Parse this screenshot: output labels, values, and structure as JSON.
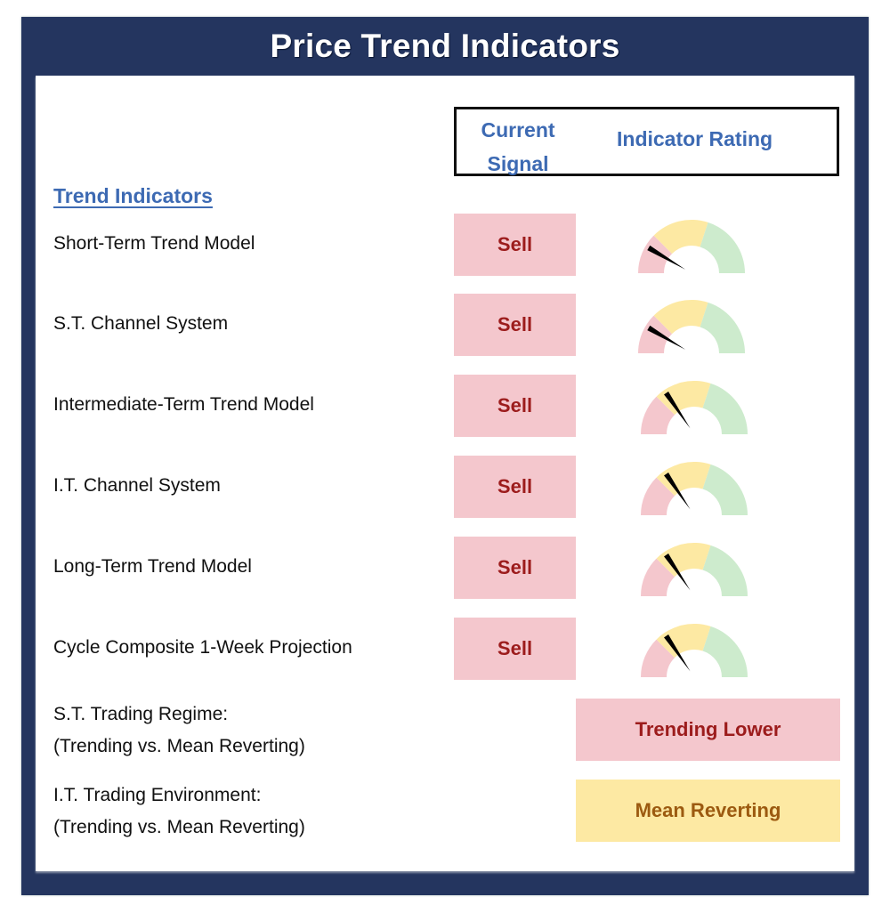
{
  "title": "Price Trend Indicators",
  "header": {
    "signal_line1": "Current",
    "signal_line2": "Signal",
    "rating": "Indicator Rating"
  },
  "section_heading": "Trend Indicators",
  "gauge_zones": {
    "red": {
      "from": 0.0,
      "to": 0.25,
      "color": "#f4c7cd"
    },
    "yellow": {
      "from": 0.25,
      "to": 0.6,
      "color": "#fde9a3"
    },
    "green": {
      "from": 0.6,
      "to": 1.0,
      "color": "#cdebcd"
    }
  },
  "indicators": [
    {
      "label": "Short-Term Trend Model",
      "signal": "Sell",
      "rating": 0.17
    },
    {
      "label": "S.T. Channel System",
      "signal": "Sell",
      "rating": 0.17
    },
    {
      "label": "Intermediate-Term Trend Model",
      "signal": "Sell",
      "rating": 0.31
    },
    {
      "label": "I.T. Channel System",
      "signal": "Sell",
      "rating": 0.31
    },
    {
      "label": "Long-Term Trend Model",
      "signal": "Sell",
      "rating": 0.31
    },
    {
      "label": "Cycle Composite 1-Week Projection",
      "signal": "Sell",
      "rating": 0.31
    }
  ],
  "regimes": [
    {
      "label_line1": "S.T. Trading Regime:",
      "label_line2": "(Trending vs. Mean Reverting)",
      "value": "Trending Lower",
      "bg": "#f4c7cd",
      "fg": "#9c1c1c"
    },
    {
      "label_line1": "I.T. Trading Environment:",
      "label_line2": "(Trending vs. Mean Reverting)",
      "value": "Mean Reverting",
      "bg": "#fde9a3",
      "fg": "#9c5a10"
    }
  ],
  "colors": {
    "frame": "#24355f",
    "heading_blue": "#3d6ab3",
    "sell_text": "#9c1c1c",
    "needle": "#000000"
  }
}
